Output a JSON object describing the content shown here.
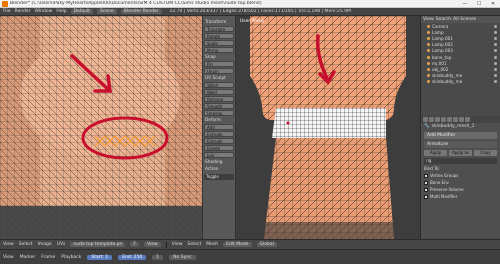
{
  "window": {
    "title": "Blender* [C:\\Users\\Paky-MyHeartsApple000\\Documents\\SIM 4 CUSTOM CC\\Sims studio mesh\\nude top.blend]",
    "minimize": "—",
    "maximize": "☐",
    "close": "✕"
  },
  "infobar": {
    "menus": [
      "File",
      "Render",
      "Window",
      "Help"
    ],
    "layout": "Default",
    "scene": "Scene",
    "engine": "Blender Render",
    "stats": "v2.70 | Verts:203/337 | Edges:378/502 | Faces:171/165 | Tris:2,198 | Mem:25.9M"
  },
  "uv_tools": {
    "sections": [
      "Transform",
      "Snap",
      "UV Sculpt",
      "Deform",
      "Shading",
      "Action"
    ],
    "buttons": [
      "Translate",
      "Rotate",
      "Scale",
      "Mirror",
      "Pin",
      "Unpin",
      "Stitch",
      "Weld",
      "Remove",
      "Smooth",
      "Unwrap",
      "Add",
      "Extrude",
      "Extrude",
      "Delete",
      "Join"
    ],
    "toggle_label": "Toggle"
  },
  "viewport": {
    "label": "User Persp",
    "object_label": "(1) tri_cloth"
  },
  "outliner": {
    "view": "View",
    "search": "Search",
    "all_scenes": "All Scenes",
    "items": [
      "Camera",
      "Lamp",
      "Lamp.001",
      "Lamp.002",
      "Lamp.003",
      "bone_top",
      "mj.001",
      "obj_002",
      "skinbuddy_me",
      "skinbuddy_me"
    ]
  },
  "properties": {
    "object_name": "skinbuddy_mesh_1",
    "add_modifier": "Add Modifier",
    "modifier_name": "Armature",
    "apply_label": "Apply",
    "apply_as_label": "Apply as",
    "copy_label": "Copy",
    "object_field": "rig",
    "bind_to": "Bind To:",
    "vertex_groups": "Vertex Groups",
    "bone_env": "Bone Env",
    "preserve": "Preserve Volume",
    "multi_mod": "Multi Modifier"
  },
  "uv_header": {
    "menus": [
      "View",
      "Select",
      "Image",
      "UVs"
    ],
    "image_name": "nude top template.pn",
    "image_slot": "F",
    "view_label": "View"
  },
  "viewport_header": {
    "menus": [
      "View",
      "Select",
      "Mesh"
    ],
    "mode": "Edit Mode",
    "pivot": "Global"
  },
  "timeline": {
    "menus": [
      "View",
      "Marker",
      "Frame",
      "Playback"
    ],
    "start_label": "Start: 1",
    "end_label": "End: 250",
    "current_frame": "1",
    "sync": "No Sync"
  },
  "colors": {
    "skin": "#f2a277",
    "wire": "#1f1f1f",
    "annotation": "#c8102e",
    "selected": "#ff9a1f"
  }
}
